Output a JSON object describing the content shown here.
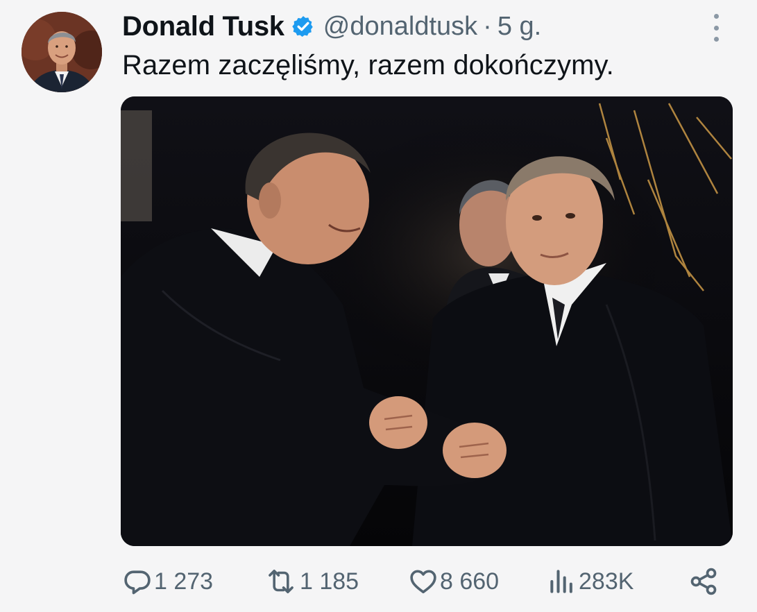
{
  "author": {
    "display_name": "Donald Tusk",
    "handle": "@donaldtusk",
    "separator": "·",
    "time_ago": "5 g.",
    "verified": true,
    "verified_color": "#1d9bf0"
  },
  "tweet": {
    "text": "Razem zaczęliśmy, razem dokończymy."
  },
  "media": {
    "kind": "photo",
    "alt_description": ""
  },
  "actions": {
    "reply_count": "1 273",
    "retweet_count": "1 185",
    "like_count": "8 660",
    "views_count": "283K",
    "reply_icon": "reply-icon",
    "retweet_icon": "retweet-icon",
    "like_icon": "heart-icon",
    "views_icon": "views-icon",
    "share_icon": "share-icon"
  },
  "colors": {
    "text_primary": "#0f1419",
    "text_secondary": "#536471",
    "background": "#f5f5f6"
  }
}
